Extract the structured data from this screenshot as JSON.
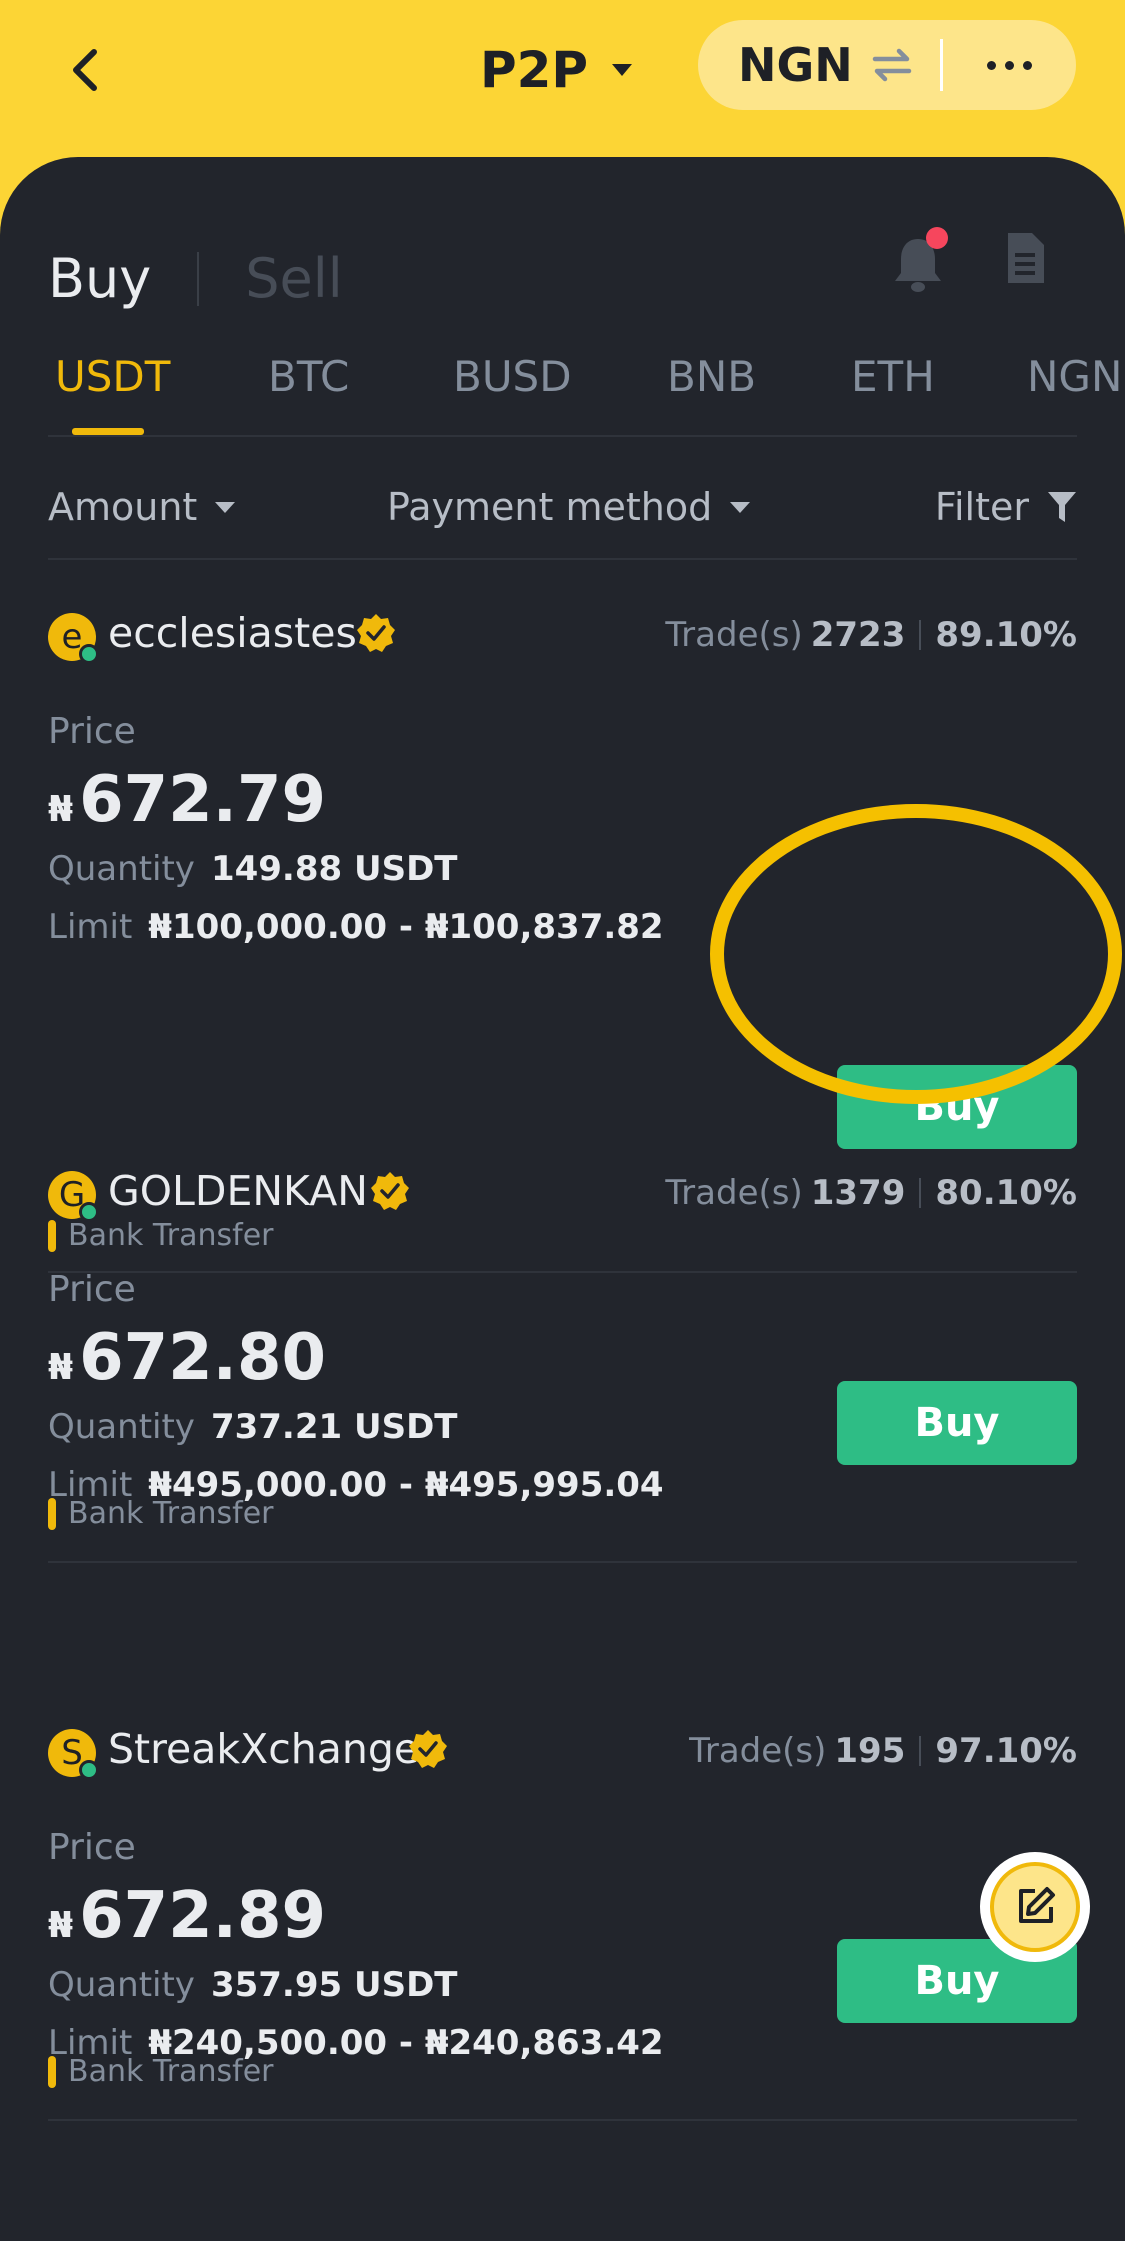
{
  "header": {
    "title": "P2P",
    "currency": "NGN",
    "back_icon": "chevron-left-icon",
    "swap_icon": "swap-icon",
    "more_icon": "more-dots-icon"
  },
  "sides": {
    "buy": "Buy",
    "sell": "Sell"
  },
  "icons": {
    "bell": "bell-icon",
    "orders": "document-icon"
  },
  "tabs": [
    "USDT",
    "BTC",
    "BUSD",
    "BNB",
    "ETH",
    "NGN"
  ],
  "active_tab": "USDT",
  "filters": {
    "amount": "Amount",
    "payment": "Payment method",
    "filter": "Filter"
  },
  "listings": [
    {
      "initial": "e",
      "name": "ecclesiastes",
      "trades_label": "Trade(s)",
      "trades": "2723",
      "completion": "89.10%",
      "price_label": "Price",
      "currency_symbol": "₦",
      "price": "672.79",
      "quantity_label": "Quantity",
      "quantity": "149.88 USDT",
      "limit_label": "Limit",
      "limit": "₦100,000.00 - ₦100,837.82",
      "button": "Buy",
      "payment": "Bank Transfer"
    },
    {
      "initial": "G",
      "name": "GOLDENKAN",
      "trades_label": "Trade(s)",
      "trades": "1379",
      "completion": "80.10%",
      "price_label": "Price",
      "currency_symbol": "₦",
      "price": "672.80",
      "quantity_label": "Quantity",
      "quantity": "737.21 USDT",
      "limit_label": "Limit",
      "limit": "₦495,000.00 - ₦495,995.04",
      "button": "Buy",
      "payment": "Bank Transfer"
    },
    {
      "initial": "S",
      "name": "StreakXchange",
      "trades_label": "Trade(s)",
      "trades": "195",
      "completion": "97.10%",
      "price_label": "Price",
      "currency_symbol": "₦",
      "price": "672.89",
      "quantity_label": "Quantity",
      "quantity": "357.95 USDT",
      "limit_label": "Limit",
      "limit": "₦240,500.00 - ₦240,863.42",
      "button": "Buy",
      "payment": "Bank Transfer"
    }
  ],
  "colors": {
    "brand_yellow": "#FCD535",
    "accent": "#F0B90B",
    "buy_green": "#2EBD85",
    "background": "#22252C"
  }
}
